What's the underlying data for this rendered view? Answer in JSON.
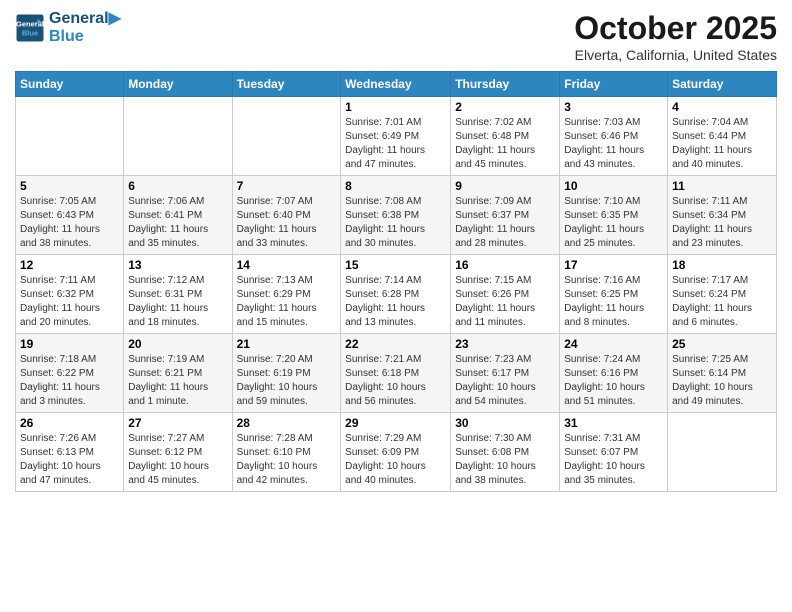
{
  "header": {
    "logo_line1": "General",
    "logo_line2": "Blue",
    "month": "October 2025",
    "location": "Elverta, California, United States"
  },
  "weekdays": [
    "Sunday",
    "Monday",
    "Tuesday",
    "Wednesday",
    "Thursday",
    "Friday",
    "Saturday"
  ],
  "weeks": [
    [
      {
        "day": "",
        "info": ""
      },
      {
        "day": "",
        "info": ""
      },
      {
        "day": "",
        "info": ""
      },
      {
        "day": "1",
        "info": "Sunrise: 7:01 AM\nSunset: 6:49 PM\nDaylight: 11 hours\nand 47 minutes."
      },
      {
        "day": "2",
        "info": "Sunrise: 7:02 AM\nSunset: 6:48 PM\nDaylight: 11 hours\nand 45 minutes."
      },
      {
        "day": "3",
        "info": "Sunrise: 7:03 AM\nSunset: 6:46 PM\nDaylight: 11 hours\nand 43 minutes."
      },
      {
        "day": "4",
        "info": "Sunrise: 7:04 AM\nSunset: 6:44 PM\nDaylight: 11 hours\nand 40 minutes."
      }
    ],
    [
      {
        "day": "5",
        "info": "Sunrise: 7:05 AM\nSunset: 6:43 PM\nDaylight: 11 hours\nand 38 minutes."
      },
      {
        "day": "6",
        "info": "Sunrise: 7:06 AM\nSunset: 6:41 PM\nDaylight: 11 hours\nand 35 minutes."
      },
      {
        "day": "7",
        "info": "Sunrise: 7:07 AM\nSunset: 6:40 PM\nDaylight: 11 hours\nand 33 minutes."
      },
      {
        "day": "8",
        "info": "Sunrise: 7:08 AM\nSunset: 6:38 PM\nDaylight: 11 hours\nand 30 minutes."
      },
      {
        "day": "9",
        "info": "Sunrise: 7:09 AM\nSunset: 6:37 PM\nDaylight: 11 hours\nand 28 minutes."
      },
      {
        "day": "10",
        "info": "Sunrise: 7:10 AM\nSunset: 6:35 PM\nDaylight: 11 hours\nand 25 minutes."
      },
      {
        "day": "11",
        "info": "Sunrise: 7:11 AM\nSunset: 6:34 PM\nDaylight: 11 hours\nand 23 minutes."
      }
    ],
    [
      {
        "day": "12",
        "info": "Sunrise: 7:11 AM\nSunset: 6:32 PM\nDaylight: 11 hours\nand 20 minutes."
      },
      {
        "day": "13",
        "info": "Sunrise: 7:12 AM\nSunset: 6:31 PM\nDaylight: 11 hours\nand 18 minutes."
      },
      {
        "day": "14",
        "info": "Sunrise: 7:13 AM\nSunset: 6:29 PM\nDaylight: 11 hours\nand 15 minutes."
      },
      {
        "day": "15",
        "info": "Sunrise: 7:14 AM\nSunset: 6:28 PM\nDaylight: 11 hours\nand 13 minutes."
      },
      {
        "day": "16",
        "info": "Sunrise: 7:15 AM\nSunset: 6:26 PM\nDaylight: 11 hours\nand 11 minutes."
      },
      {
        "day": "17",
        "info": "Sunrise: 7:16 AM\nSunset: 6:25 PM\nDaylight: 11 hours\nand 8 minutes."
      },
      {
        "day": "18",
        "info": "Sunrise: 7:17 AM\nSunset: 6:24 PM\nDaylight: 11 hours\nand 6 minutes."
      }
    ],
    [
      {
        "day": "19",
        "info": "Sunrise: 7:18 AM\nSunset: 6:22 PM\nDaylight: 11 hours\nand 3 minutes."
      },
      {
        "day": "20",
        "info": "Sunrise: 7:19 AM\nSunset: 6:21 PM\nDaylight: 11 hours\nand 1 minute."
      },
      {
        "day": "21",
        "info": "Sunrise: 7:20 AM\nSunset: 6:19 PM\nDaylight: 10 hours\nand 59 minutes."
      },
      {
        "day": "22",
        "info": "Sunrise: 7:21 AM\nSunset: 6:18 PM\nDaylight: 10 hours\nand 56 minutes."
      },
      {
        "day": "23",
        "info": "Sunrise: 7:23 AM\nSunset: 6:17 PM\nDaylight: 10 hours\nand 54 minutes."
      },
      {
        "day": "24",
        "info": "Sunrise: 7:24 AM\nSunset: 6:16 PM\nDaylight: 10 hours\nand 51 minutes."
      },
      {
        "day": "25",
        "info": "Sunrise: 7:25 AM\nSunset: 6:14 PM\nDaylight: 10 hours\nand 49 minutes."
      }
    ],
    [
      {
        "day": "26",
        "info": "Sunrise: 7:26 AM\nSunset: 6:13 PM\nDaylight: 10 hours\nand 47 minutes."
      },
      {
        "day": "27",
        "info": "Sunrise: 7:27 AM\nSunset: 6:12 PM\nDaylight: 10 hours\nand 45 minutes."
      },
      {
        "day": "28",
        "info": "Sunrise: 7:28 AM\nSunset: 6:10 PM\nDaylight: 10 hours\nand 42 minutes."
      },
      {
        "day": "29",
        "info": "Sunrise: 7:29 AM\nSunset: 6:09 PM\nDaylight: 10 hours\nand 40 minutes."
      },
      {
        "day": "30",
        "info": "Sunrise: 7:30 AM\nSunset: 6:08 PM\nDaylight: 10 hours\nand 38 minutes."
      },
      {
        "day": "31",
        "info": "Sunrise: 7:31 AM\nSunset: 6:07 PM\nDaylight: 10 hours\nand 35 minutes."
      },
      {
        "day": "",
        "info": ""
      }
    ]
  ]
}
